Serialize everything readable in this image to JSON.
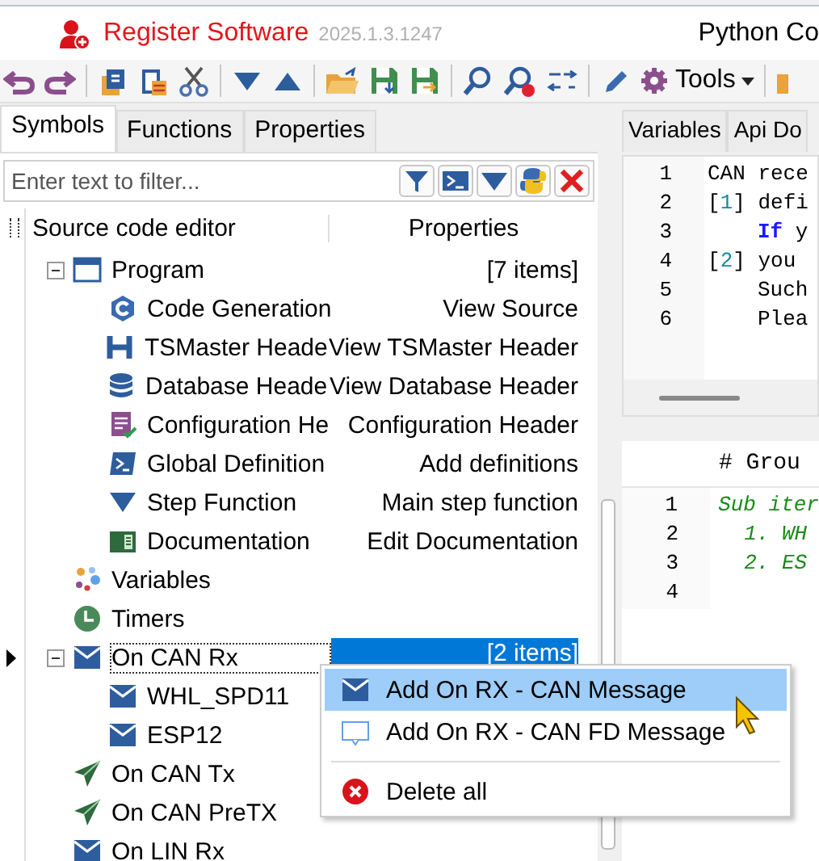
{
  "title_bar": {
    "title": "Register Software",
    "version": "2025.1.3.1247",
    "right_title": "Python Co"
  },
  "toolbar": [
    {
      "kind": "undo"
    },
    {
      "kind": "redo"
    },
    {
      "kind": "sep"
    },
    {
      "kind": "copy"
    },
    {
      "kind": "paste"
    },
    {
      "kind": "cut"
    },
    {
      "kind": "sep"
    },
    {
      "kind": "down"
    },
    {
      "kind": "up"
    },
    {
      "kind": "sep"
    },
    {
      "kind": "open"
    },
    {
      "kind": "save"
    },
    {
      "kind": "saveas"
    },
    {
      "kind": "sep"
    },
    {
      "kind": "search"
    },
    {
      "kind": "searchclear"
    },
    {
      "kind": "replace"
    },
    {
      "kind": "sep"
    },
    {
      "kind": "pencil"
    },
    {
      "kind": "tools",
      "label": "Tools"
    },
    {
      "kind": "sep"
    },
    {
      "kind": "folder"
    }
  ],
  "left_tabs": [
    {
      "label": "Symbols",
      "selected": true
    },
    {
      "label": "Functions",
      "selected": false
    },
    {
      "label": "Properties",
      "selected": false
    }
  ],
  "filter": {
    "placeholder": "Enter text to filter...",
    "buttons": [
      {
        "kind": "funnel"
      },
      {
        "kind": "terminal"
      },
      {
        "kind": "down"
      },
      {
        "kind": "python"
      },
      {
        "kind": "close"
      }
    ]
  },
  "tree": {
    "columns": [
      "Source code editor",
      "Properties"
    ],
    "items": [
      {
        "name": "Program",
        "kind": "program",
        "property": "[7 items]",
        "expanded": true,
        "selected": false,
        "children": [
          {
            "name": "Code Generation",
            "kind": "code",
            "property": "View Source"
          },
          {
            "name": "TSMaster Heade",
            "kind": "header",
            "property": "View TSMaster Header"
          },
          {
            "name": "Database Heade",
            "kind": "database",
            "property": "View Database Header"
          },
          {
            "name": "Configuration He",
            "kind": "config",
            "property": "Configuration Header"
          },
          {
            "name": "Global Definition",
            "kind": "definitions",
            "property": "Add definitions"
          },
          {
            "name": "Step Function",
            "kind": "step",
            "property": "Main step function"
          },
          {
            "name": "Documentation",
            "kind": "docs",
            "property": "Edit Documentation"
          }
        ]
      },
      {
        "name": "Variables",
        "kind": "variables",
        "selected": false
      },
      {
        "name": "Timers",
        "kind": "timers",
        "selected": false
      },
      {
        "name": "On CAN Rx",
        "kind": "message",
        "property": "[2 items]",
        "expanded": true,
        "selected": true,
        "children": [
          {
            "name": "WHL_SPD11",
            "kind": "message"
          },
          {
            "name": "ESP12",
            "kind": "message"
          }
        ]
      },
      {
        "name": "On CAN Tx",
        "kind": "send",
        "selected": false
      },
      {
        "name": "On CAN PreTX",
        "kind": "send",
        "selected": false
      },
      {
        "name": "On LIN Rx",
        "kind": "message",
        "selected": false
      }
    ]
  },
  "context_menu": [
    {
      "label": "Add On RX - CAN Message",
      "kind": "message",
      "selected": true
    },
    {
      "label": "Add On RX - CAN FD Message",
      "kind": "fd",
      "selected": false
    },
    {
      "kind": "separator"
    },
    {
      "label": "Delete all",
      "kind": "delete",
      "selected": false
    }
  ],
  "right_tabs": [
    {
      "label": "Variables",
      "selected": false
    },
    {
      "label": "Api Do",
      "selected": false
    }
  ],
  "code_top": [
    {
      "number": "1",
      "segments": [
        {
          "text": "CAN rece",
          "kind": "plain"
        }
      ]
    },
    {
      "number": "2",
      "segments": [
        {
          "text": "[",
          "kind": "plain"
        },
        {
          "text": "1",
          "kind": "number"
        },
        {
          "text": "] defi",
          "kind": "plain"
        }
      ]
    },
    {
      "number": "3",
      "indented": true,
      "segments": [
        {
          "text": "If",
          "kind": "keyword"
        },
        {
          "text": " y",
          "kind": "plain"
        }
      ]
    },
    {
      "number": "4",
      "segments": [
        {
          "text": "[",
          "kind": "plain"
        },
        {
          "text": "2",
          "kind": "number"
        },
        {
          "text": "] you",
          "kind": "plain"
        }
      ]
    },
    {
      "number": "5",
      "indented": true,
      "segments": [
        {
          "text": "Such",
          "kind": "plain"
        }
      ]
    },
    {
      "number": "6",
      "indented": true,
      "segments": [
        {
          "text": "Plea",
          "kind": "plain"
        }
      ]
    }
  ],
  "group_header": "# Grou",
  "code_bottom": [
    {
      "number": "1",
      "segments": [
        {
          "text": "Sub iter",
          "kind": "comment"
        }
      ]
    },
    {
      "number": "2",
      "segments": [
        {
          "text": "  1. WH",
          "kind": "comment"
        }
      ]
    },
    {
      "number": "3",
      "segments": [
        {
          "text": "  2. ES",
          "kind": "comment"
        }
      ]
    },
    {
      "number": "4"
    }
  ]
}
